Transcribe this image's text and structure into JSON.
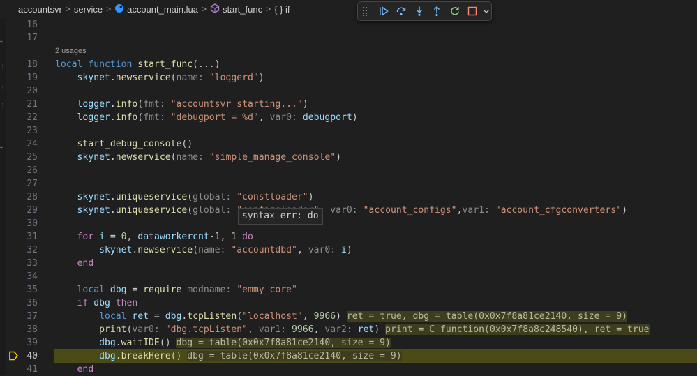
{
  "breadcrumb": {
    "items": [
      "accountsvr",
      "service",
      "account_main.lua",
      "start_func",
      "{ } if"
    ],
    "separator": ">"
  },
  "debug_toolbar": {
    "buttons": [
      {
        "name": "continue",
        "icon": "continue-icon"
      },
      {
        "name": "step-over",
        "icon": "step-over-icon"
      },
      {
        "name": "step-into",
        "icon": "step-into-icon"
      },
      {
        "name": "step-out",
        "icon": "step-out-icon"
      },
      {
        "name": "restart",
        "icon": "restart-icon"
      },
      {
        "name": "stop",
        "icon": "stop-icon"
      },
      {
        "name": "more",
        "icon": "chevron-down-icon"
      }
    ]
  },
  "codelens": {
    "usages": "2 usages"
  },
  "tooltip": {
    "text": "syntax err: do"
  },
  "current_line": 40,
  "colors": {
    "accent": "#3794ff",
    "breakpoint": "#ffcc00",
    "current_line_bg": "#4b4b18"
  },
  "lines": [
    {
      "n": "16",
      "parts": []
    },
    {
      "n": "17",
      "parts": []
    },
    {
      "n": "18",
      "parts": [
        [
          "k",
          "local "
        ],
        [
          "k",
          "function "
        ],
        [
          "f",
          "start_func"
        ],
        [
          "p",
          "(...)"
        ]
      ]
    },
    {
      "n": "19",
      "parts": [
        [
          "p",
          "    "
        ],
        [
          "v",
          "skynet"
        ],
        [
          "p",
          "."
        ],
        [
          "f",
          "newservice"
        ],
        [
          "p",
          "("
        ],
        [
          "h",
          "name: "
        ],
        [
          "s",
          "\"loggerd\""
        ],
        [
          "p",
          ")"
        ]
      ]
    },
    {
      "n": "20",
      "parts": []
    },
    {
      "n": "21",
      "parts": [
        [
          "p",
          "    "
        ],
        [
          "v",
          "logger"
        ],
        [
          "p",
          "."
        ],
        [
          "f",
          "info"
        ],
        [
          "p",
          "("
        ],
        [
          "h",
          "fmt: "
        ],
        [
          "s",
          "\"accountsvr starting...\""
        ],
        [
          "p",
          ")"
        ]
      ]
    },
    {
      "n": "22",
      "parts": [
        [
          "p",
          "    "
        ],
        [
          "v",
          "logger"
        ],
        [
          "p",
          "."
        ],
        [
          "f",
          "info"
        ],
        [
          "p",
          "("
        ],
        [
          "h",
          "fmt: "
        ],
        [
          "s",
          "\"debugport = %d\""
        ],
        [
          "p",
          ", "
        ],
        [
          "h",
          "var0: "
        ],
        [
          "v",
          "debugport"
        ],
        [
          "p",
          ")"
        ]
      ]
    },
    {
      "n": "23",
      "parts": []
    },
    {
      "n": "24",
      "parts": [
        [
          "p",
          "    "
        ],
        [
          "f",
          "start_debug_console"
        ],
        [
          "p",
          "()"
        ]
      ]
    },
    {
      "n": "25",
      "parts": [
        [
          "p",
          "    "
        ],
        [
          "v",
          "skynet"
        ],
        [
          "p",
          "."
        ],
        [
          "f",
          "newservice"
        ],
        [
          "p",
          "("
        ],
        [
          "h",
          "name: "
        ],
        [
          "s",
          "\"simple_manage_console\""
        ],
        [
          "p",
          ")"
        ]
      ]
    },
    {
      "n": "26",
      "parts": []
    },
    {
      "n": "27",
      "parts": []
    },
    {
      "n": "28",
      "parts": [
        [
          "p",
          "    "
        ],
        [
          "v",
          "skynet"
        ],
        [
          "p",
          "."
        ],
        [
          "f",
          "uniqueservice"
        ],
        [
          "p",
          "("
        ],
        [
          "h",
          "global: "
        ],
        [
          "s",
          "\"constloader\""
        ],
        [
          "p",
          ")"
        ]
      ]
    },
    {
      "n": "29",
      "parts": [
        [
          "p",
          "    "
        ],
        [
          "v",
          "skynet"
        ],
        [
          "p",
          "."
        ],
        [
          "f",
          "uniqueservice"
        ],
        [
          "p",
          "("
        ],
        [
          "h",
          "global: "
        ],
        [
          "s",
          "\"configsloader\""
        ],
        [
          "p",
          ", "
        ],
        [
          "h",
          "var0: "
        ],
        [
          "s",
          "\"account_configs\""
        ],
        [
          "p",
          ","
        ],
        [
          "h",
          "var1: "
        ],
        [
          "s",
          "\"account_cfgconverters\""
        ],
        [
          "p",
          ")"
        ]
      ]
    },
    {
      "n": "30",
      "parts": []
    },
    {
      "n": "31",
      "parts": [
        [
          "p",
          "    "
        ],
        [
          "ctl",
          "for "
        ],
        [
          "v",
          "i"
        ],
        [
          "p",
          " = "
        ],
        [
          "n",
          "0"
        ],
        [
          "p",
          ", "
        ],
        [
          "v",
          "dataworkercnt"
        ],
        [
          "p",
          "-"
        ],
        [
          "n",
          "1"
        ],
        [
          "p",
          ", "
        ],
        [
          "n",
          "1 "
        ],
        [
          "ctl",
          "do"
        ]
      ]
    },
    {
      "n": "32",
      "parts": [
        [
          "p",
          "        "
        ],
        [
          "v",
          "skynet"
        ],
        [
          "p",
          "."
        ],
        [
          "f",
          "newservice"
        ],
        [
          "p",
          "("
        ],
        [
          "h",
          "name: "
        ],
        [
          "s",
          "\"accountdbd\""
        ],
        [
          "p",
          ", "
        ],
        [
          "h",
          "var0: "
        ],
        [
          "v",
          "i"
        ],
        [
          "p",
          ")"
        ]
      ]
    },
    {
      "n": "33",
      "parts": [
        [
          "p",
          "    "
        ],
        [
          "ctl",
          "end"
        ]
      ]
    },
    {
      "n": "34",
      "parts": []
    },
    {
      "n": "35",
      "parts": [
        [
          "p",
          "    "
        ],
        [
          "k",
          "local "
        ],
        [
          "v",
          "dbg"
        ],
        [
          "p",
          " = "
        ],
        [
          "f",
          "require "
        ],
        [
          "h",
          "modname: "
        ],
        [
          "s",
          "\"emmy_core\""
        ]
      ]
    },
    {
      "n": "36",
      "parts": [
        [
          "p",
          "    "
        ],
        [
          "ctl",
          "if "
        ],
        [
          "v",
          "dbg "
        ],
        [
          "ctl",
          "then"
        ]
      ]
    },
    {
      "n": "37",
      "parts": [
        [
          "p",
          "        "
        ],
        [
          "k",
          "local "
        ],
        [
          "v",
          "ret"
        ],
        [
          "p",
          " = "
        ],
        [
          "v",
          "dbg"
        ],
        [
          "p",
          "."
        ],
        [
          "f",
          "tcpListen"
        ],
        [
          "p",
          "("
        ],
        [
          "s",
          "\"localhost\""
        ],
        [
          "p",
          ", "
        ],
        [
          "n",
          "9966"
        ],
        [
          "p",
          ") "
        ],
        [
          "iv",
          "ret = true, dbg = table(0x0x7f8a81ce2140, size = 9)"
        ]
      ]
    },
    {
      "n": "38",
      "parts": [
        [
          "p",
          "        "
        ],
        [
          "f",
          "print"
        ],
        [
          "p",
          "("
        ],
        [
          "h",
          "var0: "
        ],
        [
          "s",
          "\"dbg.tcpListen\""
        ],
        [
          "p",
          ", "
        ],
        [
          "h",
          "var1: "
        ],
        [
          "n",
          "9966"
        ],
        [
          "p",
          ", "
        ],
        [
          "h",
          "var2: "
        ],
        [
          "v",
          "ret"
        ],
        [
          "p",
          ") "
        ],
        [
          "iv",
          "print = C function(0x0x7f8a8c248540), ret = true"
        ]
      ]
    },
    {
      "n": "39",
      "parts": [
        [
          "p",
          "        "
        ],
        [
          "v",
          "dbg"
        ],
        [
          "p",
          "."
        ],
        [
          "f",
          "waitIDE"
        ],
        [
          "p",
          "() "
        ],
        [
          "iv",
          "dbg = table(0x0x7f8a81ce2140, size = 9)"
        ]
      ]
    },
    {
      "n": "40",
      "parts": [
        [
          "p",
          "        "
        ],
        [
          "v",
          "dbg"
        ],
        [
          "p",
          "."
        ],
        [
          "f",
          "breakHere"
        ],
        [
          "p",
          "() "
        ],
        [
          "iv",
          "dbg = table(0x0x7f8a81ce2140, size = 9)"
        ]
      ]
    },
    {
      "n": "41",
      "parts": [
        [
          "p",
          "    "
        ],
        [
          "ctl",
          "end"
        ]
      ]
    }
  ]
}
